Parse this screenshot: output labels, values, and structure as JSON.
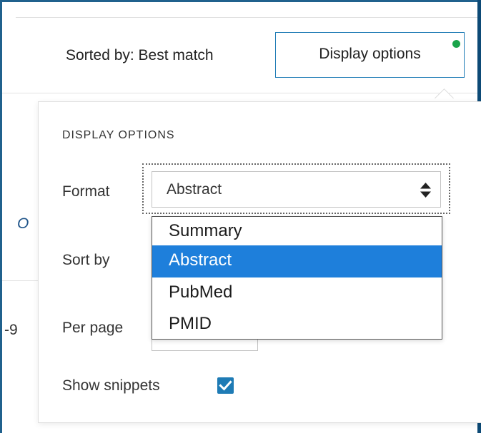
{
  "toolbar": {
    "sorted_by": "Sorted by: Best match",
    "display_options_button": "Display options"
  },
  "background": {
    "fragment_o": "O",
    "fragment_9": "-9"
  },
  "display_options": {
    "title": "DISPLAY OPTIONS",
    "format_label": "Format",
    "format_value": "Abstract",
    "sort_by_label": "Sort by",
    "per_page_label": "Per page",
    "show_snippets_label": "Show snippets",
    "show_snippets_checked": true,
    "format_options": [
      "Summary",
      "Abstract",
      "PubMed",
      "PMID"
    ],
    "format_selected_index": 1
  },
  "colors": {
    "accent": "#1e7bb5",
    "selected_option": "#1e7fdb",
    "status_dot": "#1aa44a",
    "frame": "#20618d"
  },
  "icons": {
    "select_arrows": "up-down-caret-icon",
    "checkbox": "checkmark-icon",
    "status": "status-dot-icon"
  }
}
